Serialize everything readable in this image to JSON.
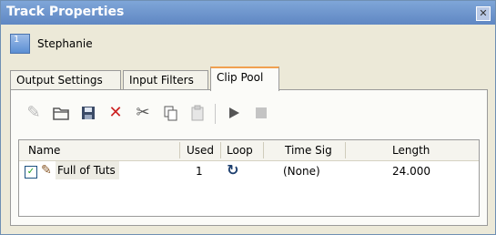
{
  "window": {
    "title": "Track Properties",
    "close_glyph": "✕"
  },
  "track": {
    "number": "1",
    "name": "Stephanie"
  },
  "tabs": [
    {
      "label": "Output Settings",
      "active": false
    },
    {
      "label": "Input Filters",
      "active": false
    },
    {
      "label": "Clip Pool",
      "active": true
    }
  ],
  "toolbar": {
    "icons": [
      "pencil-icon",
      "folder-open-icon",
      "save-icon",
      "delete-icon",
      "cut-icon",
      "copy-icon",
      "paste-icon",
      "play-icon",
      "stop-icon"
    ]
  },
  "clip_table": {
    "columns": [
      "Name",
      "Used",
      "Loop",
      "Time Sig",
      "Length"
    ],
    "rows": [
      {
        "checked": true,
        "name": "Full of Tuts",
        "used": "1",
        "loop_icon": "loop-icon",
        "time_sig": "(None)",
        "length": "24.000"
      }
    ]
  },
  "colors": {
    "titlebar": "#6f97cf",
    "active_tab_accent": "#f0a050",
    "delete_red": "#cc2222"
  }
}
